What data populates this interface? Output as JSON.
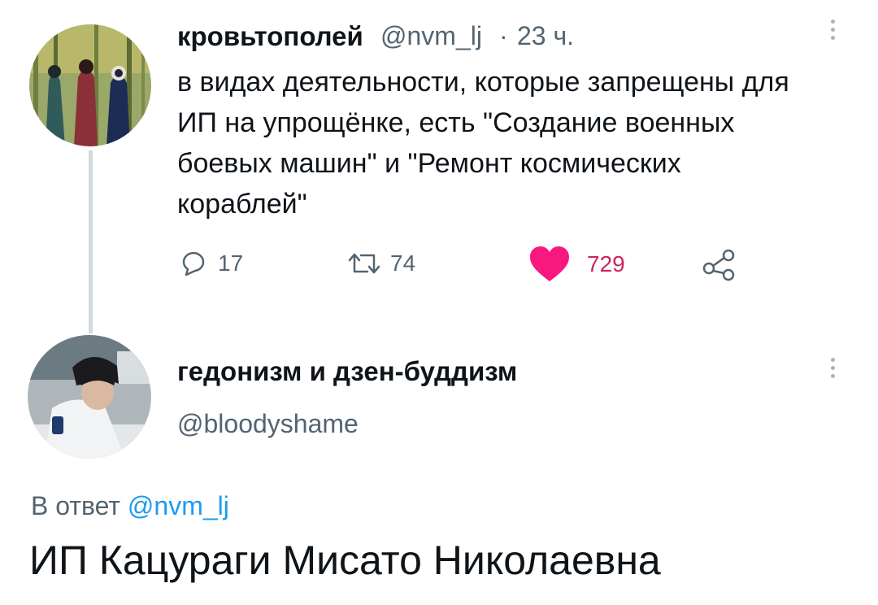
{
  "colors": {
    "accent": "#1d9bf0",
    "like": "#c9245f",
    "muted": "#536471",
    "text": "#0f1419",
    "thread_line": "#cfd9de"
  },
  "tweet": {
    "author_name": "кровьтополей",
    "handle": "@nvm_lj",
    "separator": "·",
    "time": "23 ч.",
    "text": "в видах деятельности, которые запрещены для\nИП на упрощёнке, есть \"Создание военных\nбоевых машин\" и \"Ремонт космических\nкораблей\"",
    "replies": "17",
    "retweets": "74",
    "likes": "729",
    "liked": true,
    "icons": {
      "reply": "reply-icon",
      "retweet": "retweet-icon",
      "like": "heart-icon",
      "share": "share-icon",
      "more": "more-vertical-icon"
    }
  },
  "reply": {
    "author_name": "гедонизм и дзен-буддизм",
    "handle": "@bloodyshame",
    "replying_to_prefix": "В ответ",
    "replying_to_handle": "@nvm_lj",
    "text": "ИП Кацураги Мисато Николаевна"
  }
}
